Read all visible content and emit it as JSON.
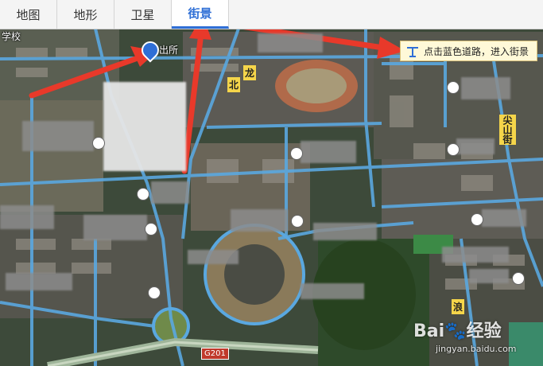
{
  "tabs": [
    {
      "label": "地图",
      "active": false
    },
    {
      "label": "地形",
      "active": false
    },
    {
      "label": "卫星",
      "active": false
    },
    {
      "label": "街景",
      "active": true
    }
  ],
  "tooltip": {
    "text": "点击蓝色道路，进入街景"
  },
  "map_labels": {
    "school": "学校",
    "station": "出所",
    "road_long": "龙",
    "road_north": "北",
    "mountain_street": "尖山街",
    "road_bottom": "浪",
    "highway": "G201"
  },
  "watermark": {
    "main": "Bai",
    "sub": "经验",
    "url": "jingyan.baidu.com"
  },
  "colors": {
    "active_tab": "#2f6fd6",
    "arrow": "#e8392a",
    "road": "#5aa8e0",
    "tooltip_bg": "#fff9d8"
  }
}
